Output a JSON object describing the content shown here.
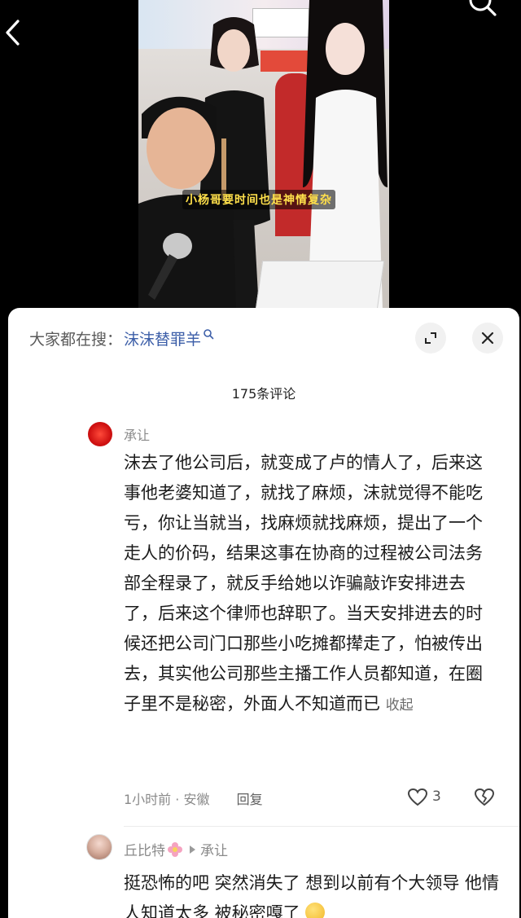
{
  "video": {
    "subtitle": "小杨哥要时间也是神情复杂",
    "back_icon": "chevron-left-icon",
    "search_icon": "search-icon"
  },
  "sheet": {
    "search_prefix": "大家都在搜：",
    "search_term": "沫沫替罪羊",
    "comment_count": "175条评论",
    "expand_icon": "expand-icon",
    "close_icon": "close-icon"
  },
  "comments": [
    {
      "author": "承让",
      "text": "沫去了他公司后，就变成了卢的情人了，后来这事他老婆知道了，就找了麻烦，沫就觉得不能吃亏，你让当就当，找麻烦就找麻烦，提出了一个走人的价码，结果这事在协商的过程被公司法务部全程录了，就反手给她以诈骗敲诈安排进去了，后来这个律师也辞职了。当天安排进去的时候还把公司门口那些小吃摊都撵走了，怕被传出去，其实他公司那些主播工作人员都知道，在圈子里不是秘密，外面人不知道而已",
      "collapse_label": "收起",
      "time": "1小时前",
      "location": "安徽",
      "reply_label": "回复",
      "likes": "3"
    },
    {
      "author": "丘比特",
      "reply_to": "承让",
      "text": "挺恐怖的吧 突然消失了 想到以前有个大领导 他情人知道太多 被秘密嘎了"
    }
  ],
  "colors": {
    "link_blue": "#3c5ea8",
    "subtitle_yellow": "#ffe04b",
    "sheet_bg": "#ffffff"
  }
}
